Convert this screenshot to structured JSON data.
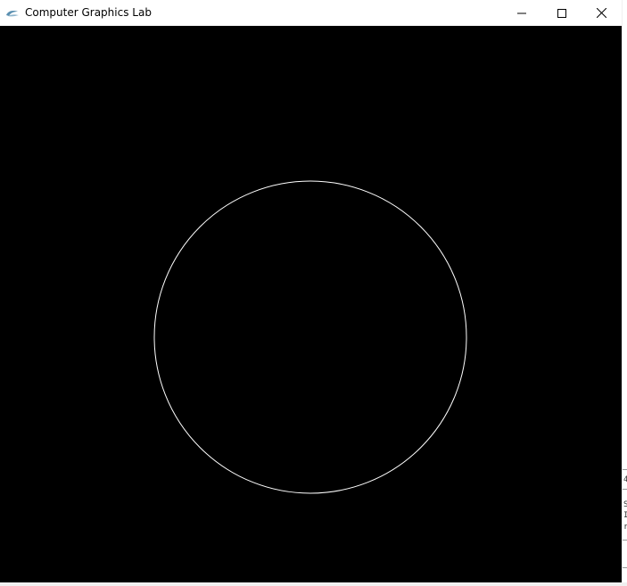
{
  "window": {
    "title": "Computer Graphics Lab",
    "icon": "app-logo-icon",
    "controls": {
      "minimize": "minimize-icon",
      "maximize": "maximize-icon",
      "close": "close-icon"
    }
  },
  "canvas": {
    "background": "#000000",
    "shape": "circle",
    "stroke_color": "#ffffff"
  },
  "background_window": {
    "fragments": [
      "4",
      "S",
      "I",
      "r"
    ]
  }
}
